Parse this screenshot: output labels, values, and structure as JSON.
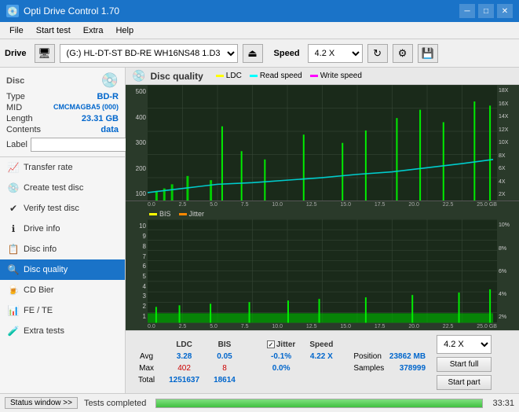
{
  "titlebar": {
    "title": "Opti Drive Control 1.70",
    "icon": "💿",
    "controls": {
      "minimize": "─",
      "maximize": "□",
      "close": "✕"
    }
  },
  "menubar": {
    "items": [
      "File",
      "Start test",
      "Extra",
      "Help"
    ]
  },
  "drivebar": {
    "label": "Drive",
    "drive_value": "(G:)  HL-DT-ST BD-RE  WH16NS48 1.D3",
    "speed_label": "Speed",
    "speed_value": "4.2 X"
  },
  "disc": {
    "type_label": "Type",
    "type_value": "BD-R",
    "mid_label": "MID",
    "mid_value": "CMCMAGBA5 (000)",
    "length_label": "Length",
    "length_value": "23.31 GB",
    "contents_label": "Contents",
    "contents_value": "data",
    "label_label": "Label",
    "label_value": ""
  },
  "nav": {
    "items": [
      {
        "id": "transfer-rate",
        "label": "Transfer rate",
        "icon": "📈"
      },
      {
        "id": "create-test-disc",
        "label": "Create test disc",
        "icon": "💿"
      },
      {
        "id": "verify-test-disc",
        "label": "Verify test disc",
        "icon": "✔"
      },
      {
        "id": "drive-info",
        "label": "Drive info",
        "icon": "ℹ"
      },
      {
        "id": "disc-info",
        "label": "Disc info",
        "icon": "📋"
      },
      {
        "id": "disc-quality",
        "label": "Disc quality",
        "icon": "🔍",
        "active": true
      },
      {
        "id": "cd-bier",
        "label": "CD Bier",
        "icon": "🍺"
      },
      {
        "id": "fe-te",
        "label": "FE / TE",
        "icon": "📊"
      },
      {
        "id": "extra-tests",
        "label": "Extra tests",
        "icon": "🧪"
      }
    ]
  },
  "disc_quality": {
    "title": "Disc quality",
    "icon": "💿",
    "legend": {
      "ldc": {
        "label": "LDC",
        "color": "#ffff00"
      },
      "read_speed": {
        "label": "Read speed",
        "color": "#00ffff"
      },
      "write_speed": {
        "label": "Write speed",
        "color": "#ff00ff"
      }
    },
    "legend2": {
      "bis": {
        "label": "BIS",
        "color": "#ffff00"
      },
      "jitter": {
        "label": "Jitter",
        "color": "#ff8800"
      }
    },
    "upper_chart": {
      "y_max": 500,
      "y_labels": [
        "500",
        "400",
        "300",
        "200",
        "100"
      ],
      "y_right_labels": [
        "18X",
        "16X",
        "14X",
        "12X",
        "10X",
        "8X",
        "6X",
        "4X",
        "2X"
      ],
      "x_labels": [
        "0.0",
        "2.5",
        "5.0",
        "7.5",
        "10.0",
        "12.5",
        "15.0",
        "17.5",
        "20.0",
        "22.5",
        "25.0 GB"
      ]
    },
    "lower_chart": {
      "y_labels": [
        "10",
        "9",
        "8",
        "7",
        "6",
        "5",
        "4",
        "3",
        "2",
        "1"
      ],
      "y_right_labels": [
        "10%",
        "8%",
        "6%",
        "4%",
        "2%"
      ],
      "x_labels": [
        "0.0",
        "2.5",
        "5.0",
        "7.5",
        "10.0",
        "12.5",
        "15.0",
        "17.5",
        "20.0",
        "22.5",
        "25.0 GB"
      ]
    },
    "stats": {
      "headers": [
        "",
        "LDC",
        "BIS",
        "",
        "Jitter",
        "Speed"
      ],
      "avg_label": "Avg",
      "avg_ldc": "3.28",
      "avg_bis": "0.05",
      "avg_jitter": "-0.1%",
      "max_label": "Max",
      "max_ldc": "402",
      "max_bis": "8",
      "max_jitter": "0.0%",
      "total_label": "Total",
      "total_ldc": "1251637",
      "total_bis": "18614",
      "speed_label": "Speed",
      "speed_value": "4.22 X",
      "position_label": "Position",
      "position_value": "23862 MB",
      "samples_label": "Samples",
      "samples_value": "378999",
      "jitter_checked": true,
      "speed_dropdown": "4.2 X"
    },
    "buttons": {
      "start_full": "Start full",
      "start_part": "Start part"
    }
  },
  "statusbar": {
    "window_btn": "Status window >>",
    "progress": 100,
    "status_text": "Tests completed",
    "time": "33:31"
  }
}
